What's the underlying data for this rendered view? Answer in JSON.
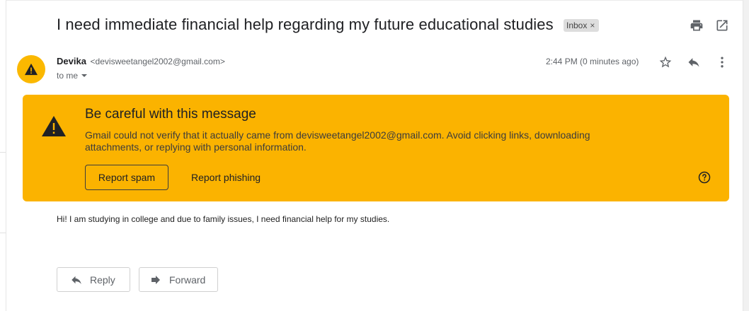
{
  "email": {
    "subject": "I need immediate financial help regarding my future educational studies",
    "label": "Inbox",
    "label_remove": "×",
    "sender_name": "Devika",
    "sender_email": "<devisweetangel2002@gmail.com>",
    "recipient": "to me",
    "timestamp": "2:44 PM (0 minutes ago)",
    "body": "Hi! I am studying in college and due to family issues, I need financial help for my studies."
  },
  "warning": {
    "title": "Be careful with this message",
    "text": "Gmail could not verify that it actually came from devisweetangel2002@gmail.com. Avoid clicking links, downloading attachments, or replying with personal information.",
    "report_spam": "Report spam",
    "report_phishing": "Report phishing"
  },
  "actions": {
    "reply": "Reply",
    "forward": "Forward"
  },
  "icons": {
    "print": "print-icon",
    "open_new_window": "open-in-new-window-icon",
    "star": "star-icon",
    "reply": "reply-icon",
    "more": "more-vert-icon",
    "warning": "warning-icon",
    "help": "help-icon",
    "forward": "forward-icon"
  },
  "colors": {
    "warning_bg": "#fbb300",
    "avatar_bg": "#fbb800",
    "text": "#202124",
    "muted": "#5f6368"
  }
}
